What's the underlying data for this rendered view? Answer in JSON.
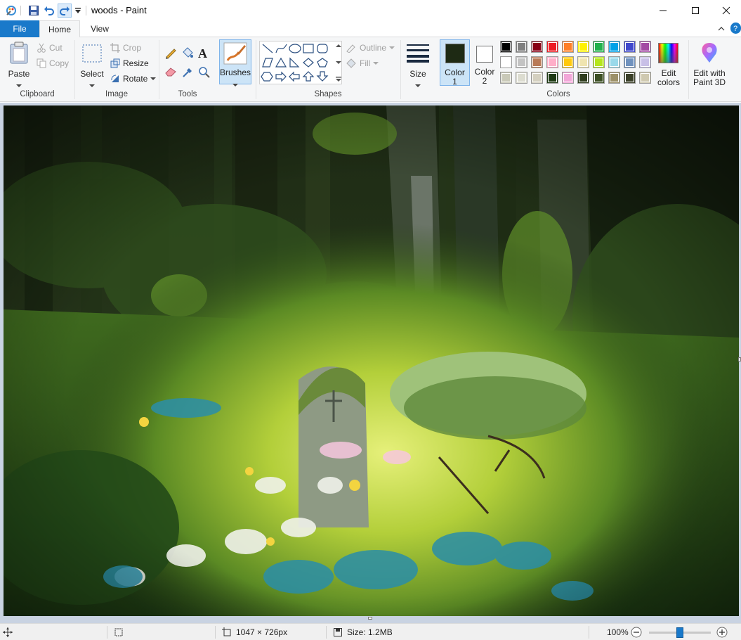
{
  "window": {
    "title": "woods - Paint",
    "controls": [
      "minimize",
      "maximize",
      "close"
    ]
  },
  "tabs": [
    {
      "label": "File"
    },
    {
      "label": "Home"
    },
    {
      "label": "View"
    }
  ],
  "ribbon": {
    "clipboard": {
      "group_label": "Clipboard",
      "paste": "Paste",
      "cut": "Cut",
      "copy": "Copy"
    },
    "image": {
      "group_label": "Image",
      "select": "Select",
      "crop": "Crop",
      "resize": "Resize",
      "rotate": "Rotate"
    },
    "tools": {
      "group_label": "Tools"
    },
    "brushes": {
      "label": "Brushes"
    },
    "shapes": {
      "group_label": "Shapes",
      "outline": "Outline",
      "fill": "Fill"
    },
    "size": {
      "label": "Size"
    },
    "color1": {
      "label_line1": "Color",
      "label_line2": "1",
      "value": "#1e2a14"
    },
    "color2": {
      "label_line1": "Color",
      "label_line2": "2",
      "value": "#ffffff"
    },
    "colors": {
      "group_label": "Colors",
      "palette": [
        [
          "#000000",
          "#7f7f7f",
          "#880015",
          "#ed1c24",
          "#ff7f27",
          "#fff200",
          "#22b14c",
          "#00a2e8",
          "#3f48cc",
          "#a349a4"
        ],
        [
          "#ffffff",
          "#c3c3c3",
          "#b97a57",
          "#ffaec9",
          "#ffc90e",
          "#efe4b0",
          "#b5e61d",
          "#99d9ea",
          "#7092be",
          "#c8bfe7"
        ],
        [
          "#c9c9b8",
          "#dcdcd0",
          "#d4d0c0",
          "#1e3a14",
          "#f2a6d8",
          "#2f3d1e",
          "#3c4f24",
          "#9c9068",
          "#3a3f28",
          "#cfc9b0"
        ]
      ],
      "edit_colors_line1": "Edit",
      "edit_colors_line2": "colors"
    },
    "paint3d": {
      "label_line1": "Edit with",
      "label_line2": "Paint 3D"
    }
  },
  "status": {
    "selection_size": "",
    "canvas_size": "1047 × 726px",
    "file_size": "Size: 1.2MB",
    "zoom": "100%",
    "zoom_level": 0.5
  }
}
